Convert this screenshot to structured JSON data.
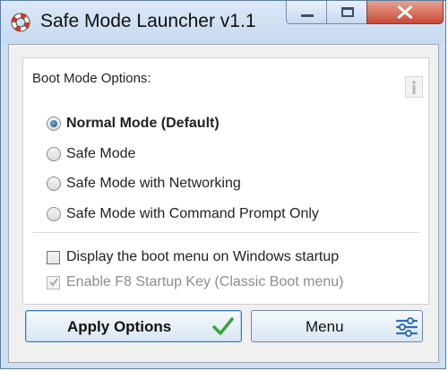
{
  "window": {
    "title": "Safe Mode Launcher v1.1",
    "icon": "lifebuoy-icon"
  },
  "panel": {
    "group_label": "Boot Mode Options:",
    "info_icon": "info-icon",
    "boot_modes": [
      {
        "label": "Normal Mode (Default)",
        "selected": true
      },
      {
        "label": "Safe Mode",
        "selected": false
      },
      {
        "label": "Safe Mode with Networking",
        "selected": false
      },
      {
        "label": "Safe Mode with Command Prompt Only",
        "selected": false
      }
    ],
    "checkboxes": [
      {
        "label": "Display the boot menu on Windows startup",
        "checked": false,
        "enabled": true
      },
      {
        "label": "Enable F8 Startup Key (Classic Boot menu)",
        "checked": true,
        "enabled": false
      }
    ]
  },
  "buttons": {
    "apply_label": "Apply Options",
    "menu_label": "Menu",
    "apply_icon": "green-check-icon",
    "menu_icon": "sliders-icon"
  },
  "colors": {
    "titlebar": "#cfe0f3",
    "close_button": "#c74a36",
    "accent_check": "#3aa33a",
    "menu_icon": "#2f6fb3"
  }
}
